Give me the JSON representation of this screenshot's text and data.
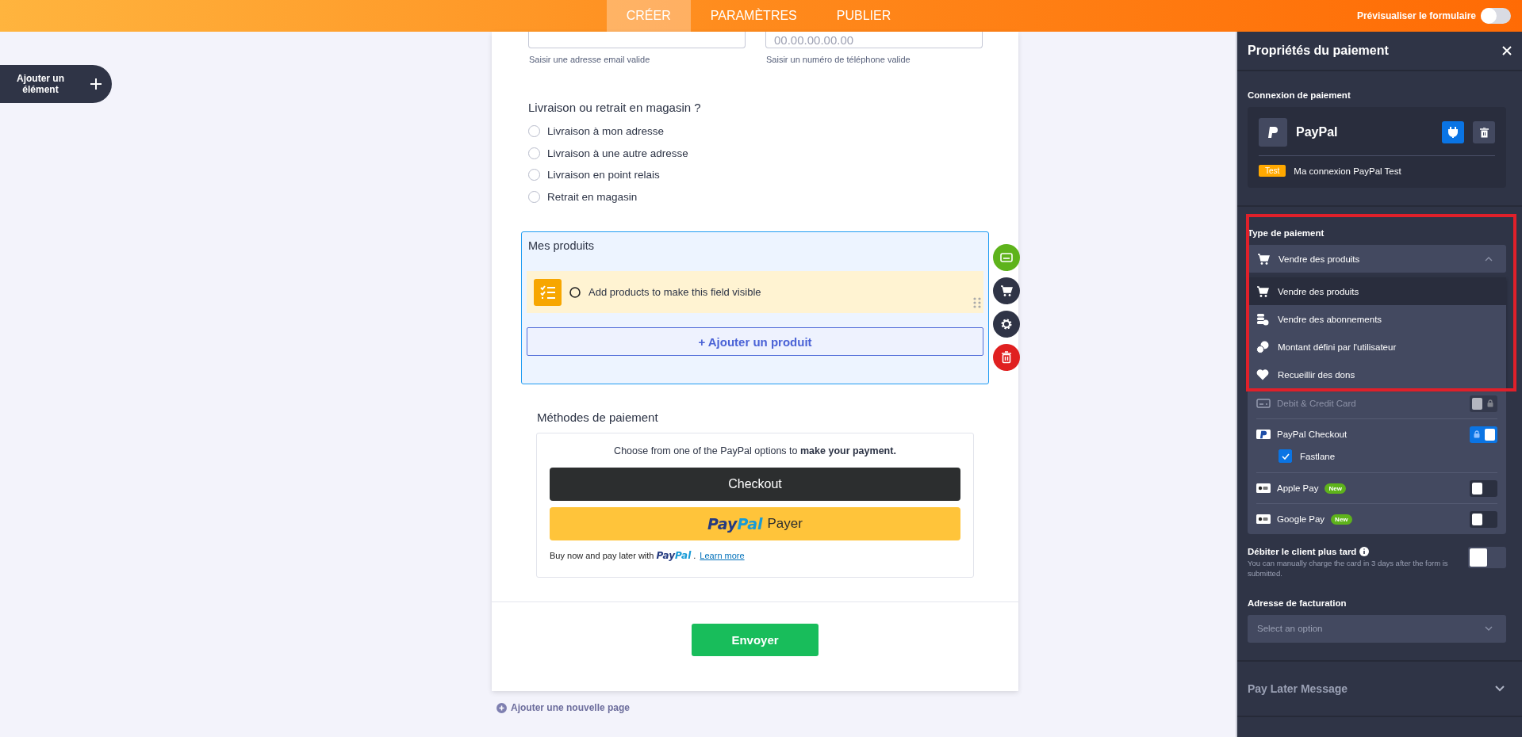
{
  "topbar": {
    "tabs": [
      {
        "label": "CRÉER",
        "selected": true
      },
      {
        "label": "PARAMÈTRES",
        "selected": false
      },
      {
        "label": "PUBLIER",
        "selected": false
      }
    ],
    "preview": {
      "label": "Prévisualiser le formulaire",
      "on": false
    }
  },
  "add_element": {
    "label": "Ajouter un élément"
  },
  "form": {
    "contact_fields": [
      {
        "helper": "Saisir une adresse email valide"
      },
      {
        "placeholder": "00.00.00.00.00",
        "helper": "Saisir un numéro de téléphone valide"
      }
    ],
    "delivery": {
      "question": "Livraison ou retrait en magasin ?",
      "options": [
        {
          "label": "Livraison à mon adresse",
          "selected": false
        },
        {
          "label": "Livraison à une autre adresse",
          "selected": false
        },
        {
          "label": "Livraison en point relais",
          "selected": false
        },
        {
          "label": "Retrait en magasin",
          "selected": false
        }
      ]
    },
    "products": {
      "title": "Mes produits",
      "notice": "Add products to make this field visible",
      "add_button": "+ Ajouter un produit"
    },
    "field_actions": [
      {
        "kind": "card",
        "color": "#5eb31b"
      },
      {
        "kind": "cart",
        "color": "#2f3446"
      },
      {
        "kind": "gear",
        "color": "#2f3446"
      },
      {
        "kind": "trash",
        "color": "#e02020"
      }
    ],
    "payment_methods": {
      "title": "Méthodes de paiement",
      "intro": "Choose from one of the PayPal options to **make your payment.**",
      "checkout_button": "Checkout",
      "paypal_button": {
        "logo": [
          "Pay",
          "Pal"
        ],
        "label": "Payer"
      },
      "pay_later": {
        "text": "Buy now and pay later with",
        "logo": [
          "Pay",
          "Pal"
        ],
        "suffix": ".",
        "link": "Learn more"
      }
    },
    "submit": "Envoyer"
  },
  "add_page": "Ajouter une nouvelle page",
  "panel": {
    "title": "Propriétés du paiement",
    "connection": {
      "heading": "Connexion de paiement",
      "provider": "PayPal",
      "badge": "Test",
      "name": "Ma connexion PayPal Test"
    },
    "payment_type": {
      "heading": "Type de paiement",
      "value": "Vendre des produits",
      "expanded": true,
      "options": [
        {
          "label": "Vendre des produits",
          "kind": "cart",
          "selected": true
        },
        {
          "label": "Vendre des abonnements",
          "kind": "subscription",
          "selected": false
        },
        {
          "label": "Montant défini par l'utilisateur",
          "kind": "coins",
          "selected": false
        },
        {
          "label": "Recueillir des dons",
          "kind": "heart",
          "selected": false
        }
      ]
    },
    "methods": [
      {
        "label": "Debit & Credit Card",
        "kind": "card",
        "on": false,
        "locked": true,
        "disabled": true
      },
      {
        "label": "PayPal Checkout",
        "kind": "paypal",
        "on": true,
        "locked": true,
        "disabled": false,
        "suboptions": [
          {
            "label": "Fastlane",
            "checked": true
          }
        ]
      },
      {
        "label": "Apple Pay",
        "kind": "wallet",
        "badge": "New",
        "on": false,
        "locked": false,
        "disabled": false
      },
      {
        "label": "Google Pay",
        "kind": "wallet",
        "badge": "New",
        "on": false,
        "locked": false,
        "disabled": false
      }
    ],
    "charge_later": {
      "label": "Débiter le client plus tard",
      "description": "You can manually charge the card in 3 days after the form is submitted.",
      "on": false
    },
    "billing": {
      "label": "Adresse de facturation",
      "placeholder": "Select an option"
    },
    "pay_later": {
      "label": "Pay Later Message",
      "expanded": false
    }
  }
}
